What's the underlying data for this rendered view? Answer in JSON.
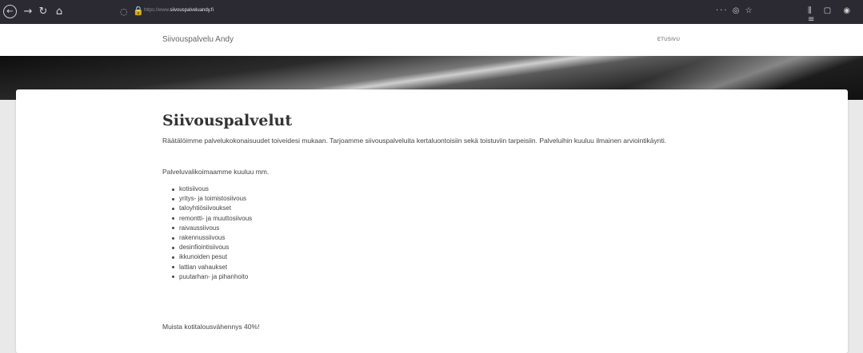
{
  "browser": {
    "back_icon": "←",
    "forward_icon": "→",
    "reload_icon": "↻",
    "home_icon": "⌂",
    "shield_icon": "◌",
    "lock_icon": "🔒",
    "url_prefix": "https://www.",
    "url_domain": "siivouspalveluandy.fi",
    "page_actions": "··· ◎ ☆",
    "right_icons": "⫼ ▢ ◉ ≡"
  },
  "header": {
    "brand": "Siivouspalvelu Andy",
    "nav_home": "ETUSIVU"
  },
  "main": {
    "title": "Siivouspalvelut",
    "intro": "Räätälöimme palvelukokonaisuudet toiveidesi mukaan. Tarjoamme siivouspalveluita kertaluontoisiin sekä toistuviin tarpeisiin. Palveluihin kuuluu ilmainen arviointikäynti.",
    "lead": "Palveluvalikoimaamme kuuluu mm.",
    "services": [
      "kotisiivous",
      "yritys- ja toimistosiivous",
      "taloyhtiösiivoukset",
      "remontti- ja muuttosiivous",
      "raivaussiivous",
      "rakennussiivous",
      "desinfiointisiivous",
      "ikkunoiden pesut",
      "lattian vahaukset",
      "puutarhan- ja pihanhoito"
    ],
    "note": "Muista kotitalousvähennys 40%!"
  }
}
